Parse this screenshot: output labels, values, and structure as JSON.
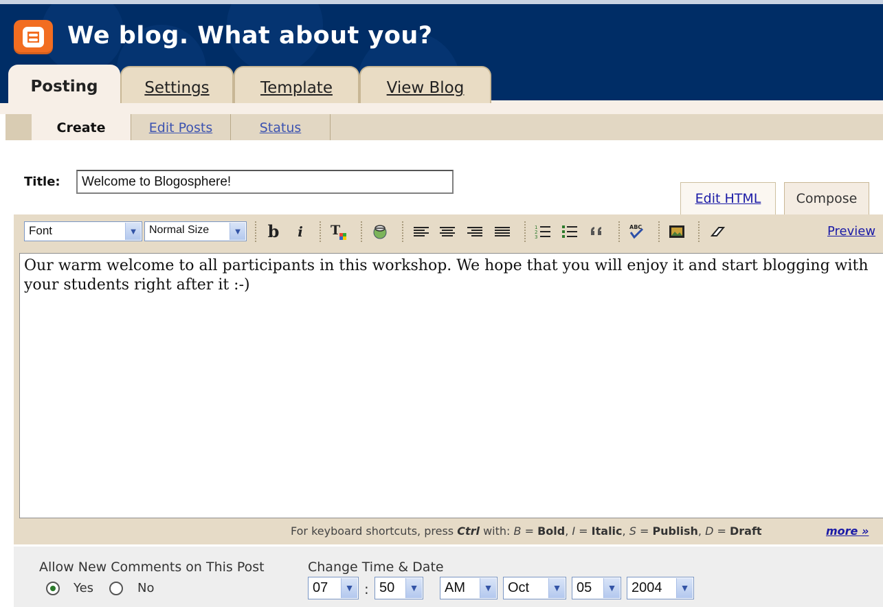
{
  "header": {
    "slogan": "We blog. What about you?",
    "brand_color": "#f26d21",
    "background_color": "#002d66"
  },
  "main_tabs": [
    {
      "label": "Posting",
      "active": true
    },
    {
      "label": "Settings",
      "active": false
    },
    {
      "label": "Template",
      "active": false
    },
    {
      "label": "View Blog",
      "active": false
    }
  ],
  "sub_tabs": [
    {
      "label": "Create",
      "active": true
    },
    {
      "label": "Edit Posts",
      "active": false
    },
    {
      "label": "Status",
      "active": false
    }
  ],
  "post": {
    "title_label": "Title:",
    "title_value": "Welcome to Blogosphere!",
    "body": "Our warm welcome to all participants in this workshop. We hope that you will enjoy it and start blogging with your students right after it :-)"
  },
  "mode_tabs": {
    "edit_html": "Edit HTML",
    "compose": "Compose"
  },
  "toolbar": {
    "font_select": "Font",
    "size_select": "Normal Size",
    "bold": "b",
    "italic": "i",
    "preview": "Preview",
    "icons": [
      "text-color-icon",
      "link-icon",
      "align-left-icon",
      "align-center-icon",
      "align-right-icon",
      "justify-icon",
      "numbered-list-icon",
      "bullet-list-icon",
      "blockquote-icon",
      "spellcheck-icon",
      "image-icon",
      "eraser-icon"
    ]
  },
  "shortcuts": {
    "prefix": "For keyboard shortcuts, press",
    "ctrl": "Ctrl",
    "with": "with:",
    "items": [
      {
        "key": "B",
        "eq": " = ",
        "label": "Bold"
      },
      {
        "key": "I",
        "eq": " = ",
        "label": "Italic"
      },
      {
        "key": "S",
        "eq": " = ",
        "label": "Publish"
      },
      {
        "key": "D",
        "eq": " = ",
        "label": "Draft"
      }
    ],
    "more": "more »"
  },
  "comments": {
    "label": "Allow New Comments on This Post",
    "yes": "Yes",
    "no": "No",
    "selected": "Yes"
  },
  "datetime": {
    "label": "Change Time & Date",
    "hour": "07",
    "separator": ":",
    "minute": "50",
    "ampm": "AM",
    "month": "Oct",
    "day": "05",
    "year": "2004"
  }
}
